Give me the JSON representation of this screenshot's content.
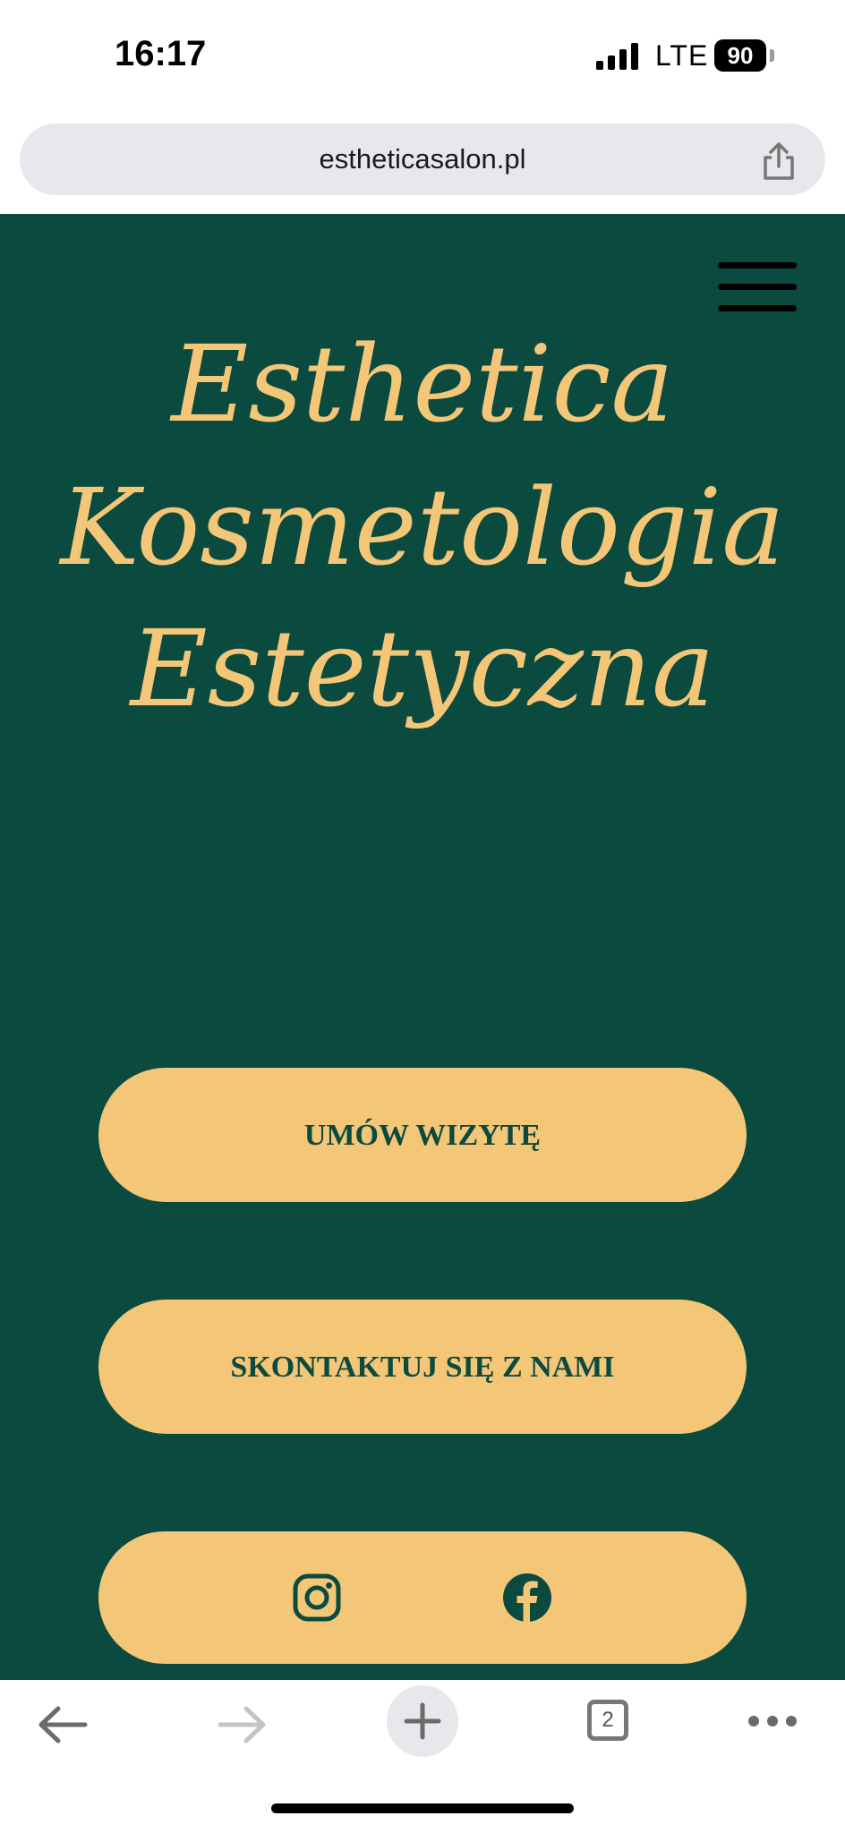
{
  "status_bar": {
    "time": "16:17",
    "network": "LTE",
    "battery": "90"
  },
  "browser": {
    "url": "estheticasalon.pl",
    "tabs_count": "2"
  },
  "hero": {
    "title_lines": [
      "Esthetica",
      "Kosmetologia",
      "Estetyczna"
    ],
    "book_button": "UMÓW WIZYTĘ",
    "contact_button": "SKONTAKTUJ SIĘ Z NAMI"
  },
  "icons": {
    "share": "share-icon",
    "menu": "hamburger-menu-icon",
    "instagram": "instagram-icon",
    "facebook": "facebook-icon",
    "back": "arrow-left-icon",
    "forward": "arrow-right-icon",
    "new_tab": "plus-icon",
    "more": "more-dots-icon"
  },
  "colors": {
    "hero_background": "#0b4a3f",
    "accent": "#f4c677",
    "url_bar": "#e6e8eb"
  }
}
